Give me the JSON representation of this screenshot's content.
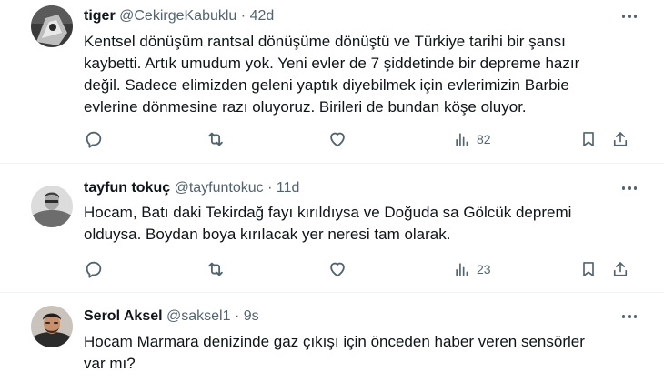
{
  "tweets": [
    {
      "name": "tiger",
      "handle": "@CekirgeKabuklu",
      "separator": "·",
      "time": "42d",
      "text": "Kentsel dönüşüm rantsal dönüşüme dönüştü ve Türkiye tarihi bir şansı\nkaybetti. Artık umudum yok. Yeni evler de 7 şiddetinde bir depreme hazır\ndeğil. Sadece elimizden geleni yaptık diyebilmek için evlerimizin Barbie\nevlerine dönmesine razı oluyoruz. Birileri de bundan köşe oluyor.",
      "views": "82"
    },
    {
      "name": "tayfun tokuç",
      "handle": "@tayfuntokuc",
      "separator": "·",
      "time": "11d",
      "text": "Hocam, Batı daki Tekirdağ fayı kırıldıysa ve Doğuda sa Gölcük depremi\nolduysa. Boydan boya kırılacak yer neresi tam olarak.",
      "views": "23"
    },
    {
      "name": "Serol Aksel",
      "handle": "@saksel1",
      "separator": "·",
      "time": "9s",
      "text": "Hocam Marmara denizinde gaz çıkışı için önceden haber veren sensörler\nvar mı?"
    }
  ],
  "icons": {
    "reply": "reply-icon",
    "retweet": "retweet-icon",
    "like": "heart-icon",
    "views": "views-chart-icon",
    "bookmark": "bookmark-icon",
    "share": "share-icon",
    "more": "more-dots-icon"
  },
  "colors": {
    "text": "#0f1419",
    "secondary": "#536471",
    "divider": "#eff3f4"
  }
}
